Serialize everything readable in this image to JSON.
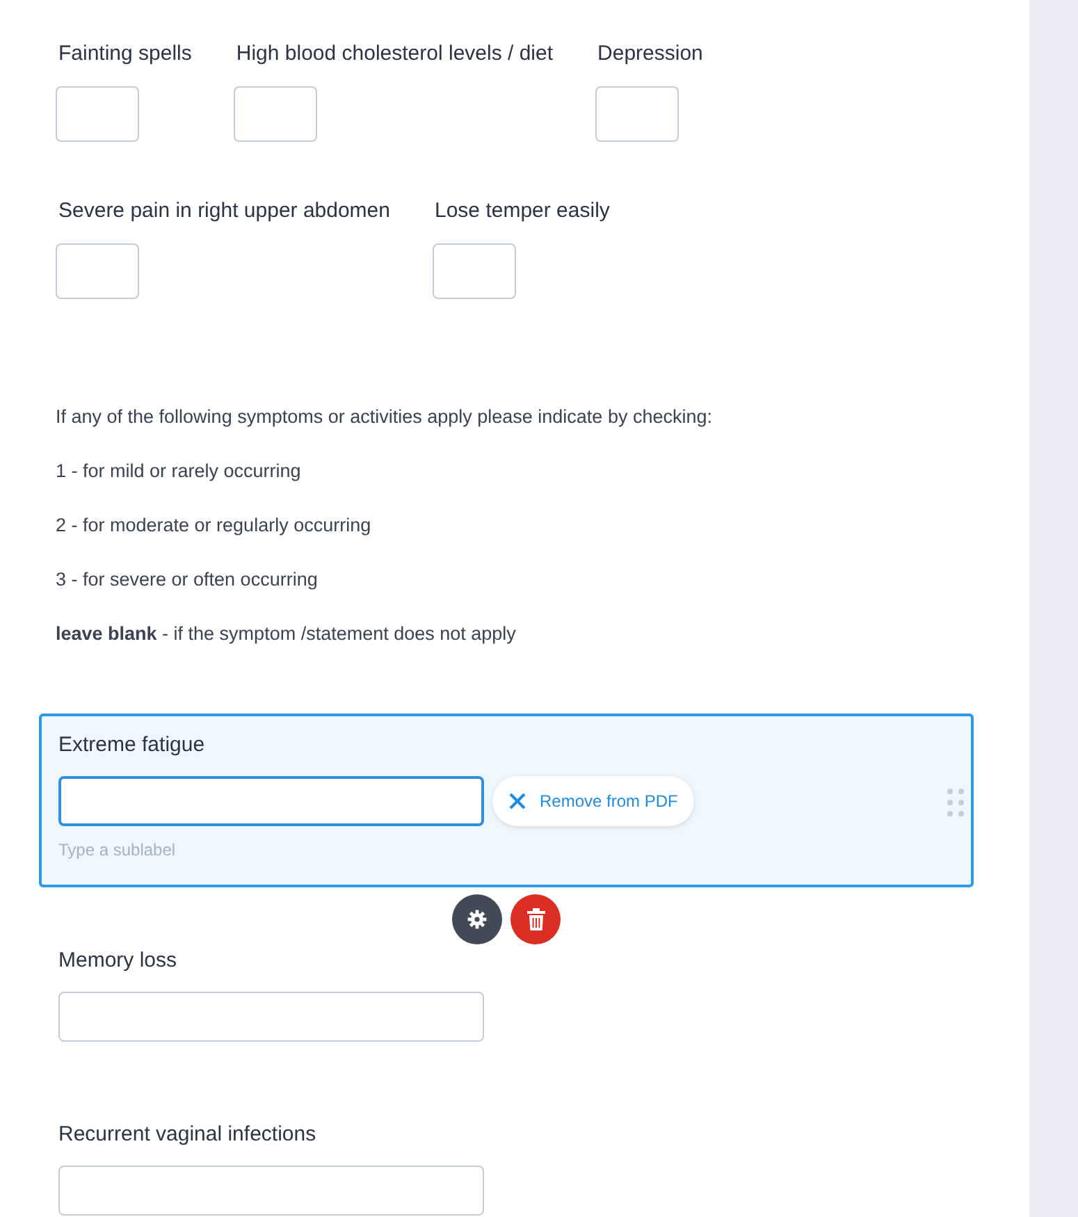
{
  "field_rows": [
    [
      {
        "label": "Fainting spells"
      },
      {
        "label": "High blood cholesterol levels / diet"
      },
      {
        "label": "Depression"
      }
    ],
    [
      {
        "label": "Severe pain in right upper abdomen"
      },
      {
        "label": "Lose temper easily"
      }
    ]
  ],
  "instructions": [
    "If any of the following symptoms or activities apply please indicate by checking:",
    "1 - for mild or rarely occurring",
    "2 - for moderate or regularly occurring",
    "3 - for severe or often occurring",
    "**leave blank** - if the symptom /statement does not apply"
  ],
  "questions": [
    {
      "label": "Extreme fatigue",
      "selected": true,
      "remove_label": "Remove from PDF",
      "sublabel_placeholder": "Type a sublabel"
    },
    {
      "label": "Memory loss",
      "selected": false
    },
    {
      "label": "Recurrent vaginal infections",
      "selected": false
    }
  ]
}
